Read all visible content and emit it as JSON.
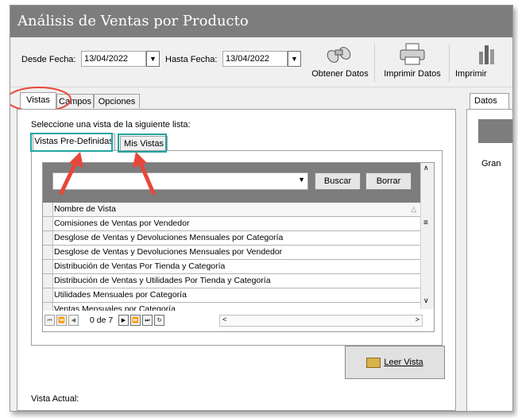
{
  "window": {
    "title": "Análisis de Ventas por Producto"
  },
  "toolbar": {
    "desde_label": "Desde Fecha:",
    "desde_value": "13/04/2022",
    "hasta_label": "Hasta Fecha:",
    "hasta_value": "13/04/2022",
    "obtener_label": "Obtener Datos",
    "imprimir_label": "Imprimir Datos",
    "imprimir2_label": "Imprimir"
  },
  "tabs": [
    "Vistas",
    "Campos",
    "Opciones"
  ],
  "right_tab": "Datos",
  "right_row_label": "Gran",
  "instruction": "Seleccione una vista de la siguiente lista:",
  "subtabs": [
    "Vistas Pre-Definidas",
    "Mis Vistas"
  ],
  "search": {
    "buscar_label": "Buscar",
    "borrar_label": "Borrar"
  },
  "grid": {
    "column_header": "Nombre de Vista",
    "rows": [
      "Comisiones de Ventas por Vendedor",
      "Desglose de Ventas y Devoluciones Mensuales por Categoría",
      "Desglose de Ventas y Devoluciones Mensuales por Vendedor",
      "Distribución de Ventas Por Tienda y Categoría",
      "Distribución de Ventas y Utilidades Por Tienda y Categoría",
      "Utilidades Mensuales por Categoría",
      "Ventas Mensuales por Categoría"
    ],
    "pager_text": "0 de 7"
  },
  "leer_vista_label": "Leer Vista",
  "vista_actual_label": "Vista Actual:",
  "colors": {
    "title_bar": "#7d7d7d",
    "highlight_teal": "#20a5a0",
    "annotation_red": "#e8473a"
  }
}
